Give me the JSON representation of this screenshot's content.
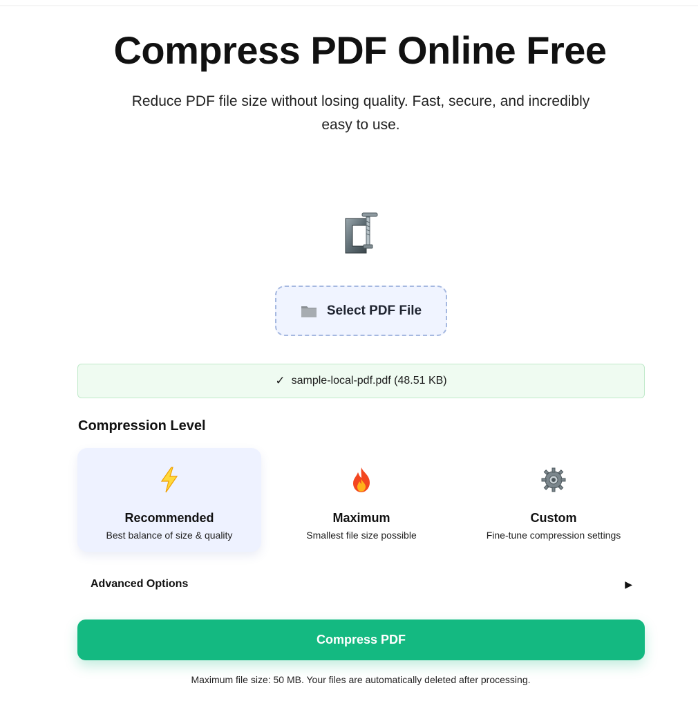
{
  "hero": {
    "title": "Compress PDF Online Free",
    "subtitle": "Reduce PDF file size without losing quality. Fast, secure, and incredibly easy to use."
  },
  "icons": {
    "hero_icon": "clamp-icon",
    "select_icon": "folder-icon",
    "recommended_icon": "lightning-icon",
    "maximum_icon": "fire-icon",
    "custom_icon": "gear-icon"
  },
  "upload": {
    "select_label": "Select PDF File",
    "file_check": "✓",
    "file_info": "sample-local-pdf.pdf (48.51 KB)"
  },
  "compression": {
    "heading": "Compression Level",
    "levels": [
      {
        "name": "Recommended",
        "desc": "Best balance of size & quality",
        "selected": true
      },
      {
        "name": "Maximum",
        "desc": "Smallest file size possible",
        "selected": false
      },
      {
        "name": "Custom",
        "desc": "Fine-tune compression settings",
        "selected": false
      }
    ]
  },
  "advanced": {
    "label": "Advanced Options",
    "arrow": "▶"
  },
  "actions": {
    "compress_label": "Compress PDF"
  },
  "footer": {
    "note": "Maximum file size: 50 MB. Your files are automatically deleted after processing."
  },
  "colors": {
    "primary_green": "#14b981",
    "selected_card_bg": "#eef2ff",
    "file_banner_bg": "#effbf1",
    "dashed_border": "#a5b8e0"
  }
}
